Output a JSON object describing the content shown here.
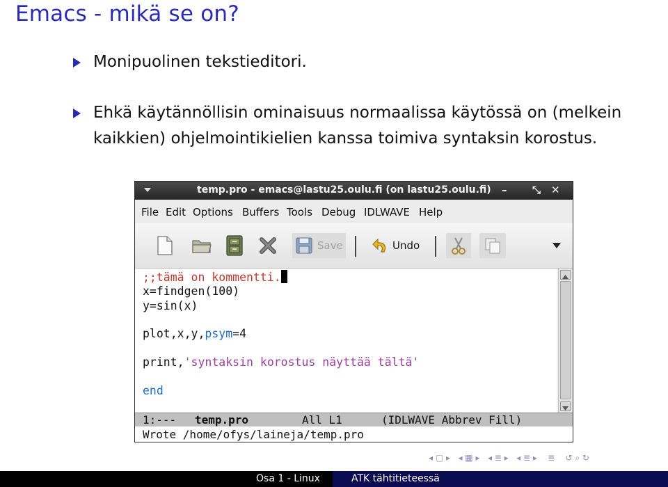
{
  "slide": {
    "title": "Emacs - mikä se on?",
    "bullets": [
      "Monipuolinen tekstieditori.",
      "Ehkä käytännöllisin ominaisuus normaalissa käytössä on (melkein kaikkien) ohjelmointikielien kanssa toimiva syntaksin korostus."
    ]
  },
  "window": {
    "title": "temp.pro - emacs@lastu25.oulu.fi (on lastu25.oulu.fi)",
    "controls": {
      "minimize": "–",
      "maximize": "⤡",
      "close": "✕"
    }
  },
  "menu": [
    "File",
    "Edit",
    "Options",
    "Buffers",
    "Tools",
    "Debug",
    "IDLWAVE",
    "Help"
  ],
  "toolbar": {
    "save_label": "Save",
    "undo_label": "Undo",
    "icons": [
      "new-file-icon",
      "open-folder-icon",
      "file-cabinet-icon",
      "close-x-icon",
      "save-disk-icon",
      "undo-arrow-icon",
      "cut-scissors-icon",
      "copy-icon",
      "dropdown-arrow-icon"
    ]
  },
  "editor": {
    "comment": ";;tämä on kommentti.",
    "line2": "x=findgen(100)",
    "line3": "y=sin(x)",
    "line4_pre": "plot,x,y,",
    "line4_kw": "psym",
    "line4_post": "=4",
    "line5_pre": "print,",
    "line5_str": "'syntaksin korostus näyttää tältä'",
    "line6": "end"
  },
  "modeline": {
    "status": "1:---",
    "buffer": "temp.pro",
    "position": "All L1",
    "modes": "(IDLWAVE Abbrev Fill)"
  },
  "minibuffer": "Wrote /home/ofys/laineja/temp.pro",
  "footer": {
    "left": "Osa 1 - Linux",
    "right": "ATK tähtitieteessä"
  },
  "colors": {
    "title": "#2a2ab8",
    "comment": "#c0392b",
    "keyword": "#1f6fc5",
    "string": "#9a3f9b",
    "footer_right_bg": "#0c0c52"
  }
}
